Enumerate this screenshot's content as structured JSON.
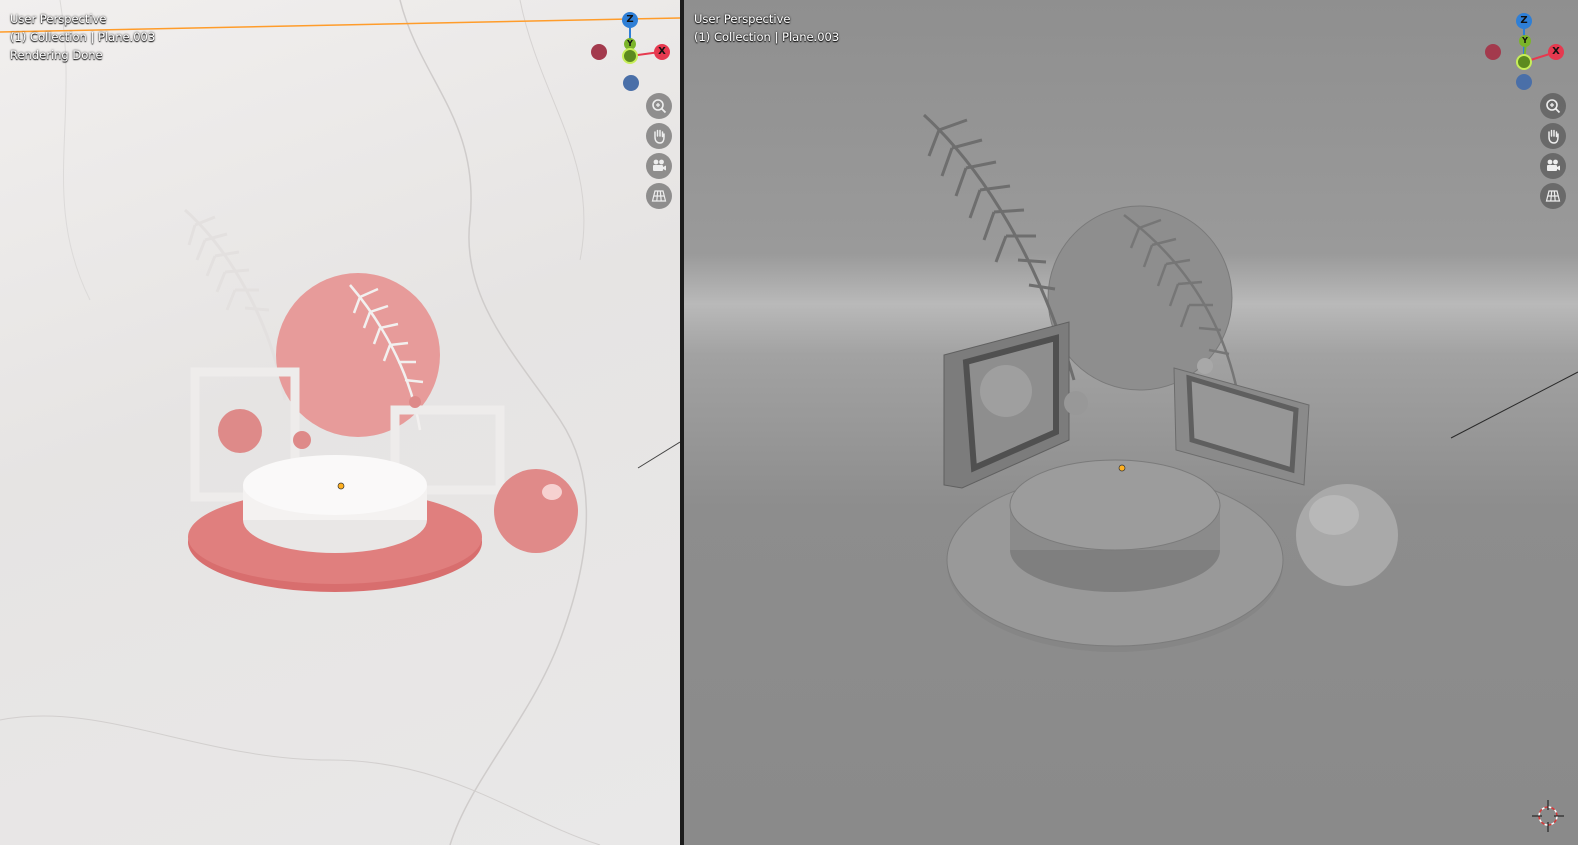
{
  "left_viewport": {
    "perspective_label": "User Perspective",
    "collection_label": "(1) Collection | Plane.003",
    "status_label": "Rendering Done",
    "shading": "rendered"
  },
  "right_viewport": {
    "perspective_label": "User Perspective",
    "collection_label": "(1) Collection | Plane.003",
    "shading": "solid"
  },
  "gizmo": {
    "z_label": "Z",
    "x_label": "X",
    "y_label": "Y",
    "colors": {
      "z": "#2f7fd6",
      "x": "#e6394f",
      "y": "#7bb42a",
      "neg_z": "#4a6fa8",
      "neg_x": "#a33a4d"
    }
  },
  "nav_buttons": [
    "zoom-icon",
    "hand-icon",
    "camera-icon",
    "grid-icon"
  ],
  "colors": {
    "accent_pink": "#d9797a",
    "active_outline": "#ff9c2a",
    "solid_gray": "#8f8f8f"
  }
}
